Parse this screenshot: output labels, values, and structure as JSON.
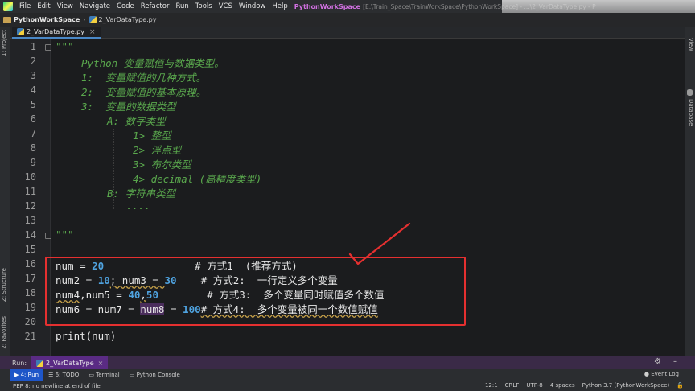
{
  "menu": {
    "items": [
      "File",
      "Edit",
      "View",
      "Navigate",
      "Code",
      "Refactor",
      "Run",
      "Tools",
      "VCS",
      "Window",
      "Help"
    ],
    "project_title": "PythonWorkSpace",
    "path_title": "[E:\\Train_Space\\TrainWorkSpace\\PythonWorkSpace] - ...\\2_VarDataType.py - P"
  },
  "nav": {
    "project": "PythonWorkSpace",
    "file": "2_VarDataType.py"
  },
  "tab": {
    "label": "2_VarDataType.py",
    "close": "×"
  },
  "side": {
    "project": "1: Project",
    "structure": "Z: Structure",
    "favorites": "2: Favorites",
    "view": "View",
    "database": "Database"
  },
  "editor": {
    "line_numbers": [
      "1",
      "2",
      "3",
      "4",
      "5",
      "6",
      "7",
      "8",
      "9",
      "10",
      "11",
      "12",
      "13",
      "14",
      "15",
      "16",
      "17",
      "18",
      "19",
      "20",
      "21"
    ],
    "doc_open": "\"\"\"",
    "doc_title": "Python 变量赋值与数据类型。",
    "doc_item1": "1:  变量赋值的几种方式。",
    "doc_item2": "2:  变量赋值的基本原理。",
    "doc_item3": "3:  变量的数据类型",
    "doc_a": "A: 数字类型",
    "doc_a1": "1> 整型",
    "doc_a2": "2> 浮点型",
    "doc_a3": "3> 布尔类型",
    "doc_a4": "4> decimal (高精度类型)",
    "doc_b": "B: 字符串类型",
    "doc_dots": "....",
    "doc_close": "\"\"\"",
    "line16": {
      "a": "num = ",
      "n1": "20",
      "b": "               ",
      "c": "# 方式1  (推荐方式)"
    },
    "line17": {
      "a": "num2 = ",
      "n1": "10",
      "b": "; num3 = ",
      "n2": "30",
      "c": "    # 方式2:  一行定义多个变量"
    },
    "line18": {
      "a": "num4",
      "b": ",num5 = ",
      "n1": "40",
      "c": ",",
      "n2": "50",
      "d": "        # 方式3:  多个变量同时赋值多个数值"
    },
    "line19": {
      "a": "num6 = num7 = ",
      "hl": "num8",
      "b": " = ",
      "n1": "100",
      "c": "# 方式4:  多个变量被同一个数值赋值"
    },
    "line21": "print(num)"
  },
  "run": {
    "label": "Run:",
    "tab": "2_VarDataType",
    "close": "×",
    "actions": "⚙ –"
  },
  "toolwindows": {
    "run": "▶ 4: Run",
    "todo": "☰ 6: TODO",
    "terminal": "▭ Terminal",
    "console": "▭ Python Console",
    "event_log": "● Event Log"
  },
  "status": {
    "message": "PEP 8: no newline at end of file",
    "position": "12:1",
    "line_sep": "CRLF",
    "encoding": "UTF-8",
    "indent": "4 spaces",
    "interpreter": "Python 3.7 (PythonWorkSpace)",
    "lock": "🔒"
  },
  "colors": {
    "annotation_red": "#e53030",
    "docstring_green": "#5aa84d",
    "number_blue": "#4fa3e0",
    "run_bar_purple": "#5a2b84"
  }
}
